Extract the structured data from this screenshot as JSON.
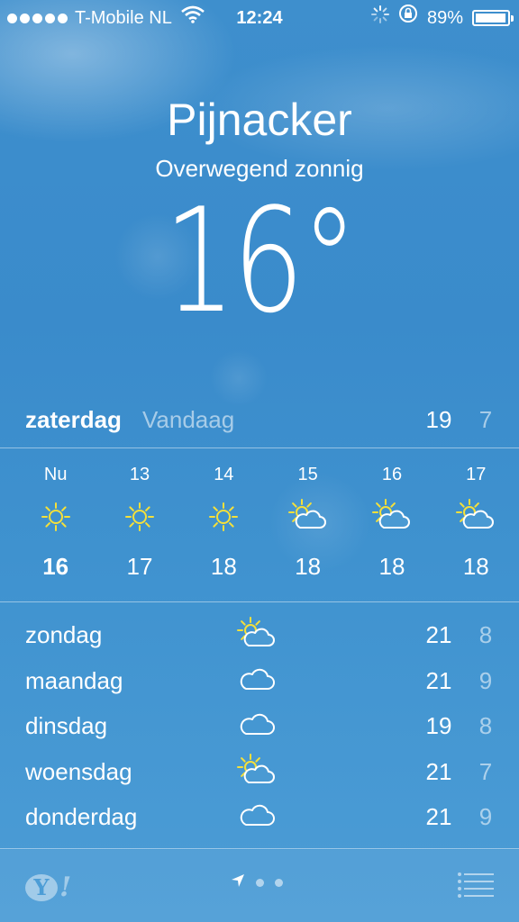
{
  "status_bar": {
    "carrier": "T-Mobile NL",
    "time": "12:24",
    "battery": "89%",
    "battery_level": 0.89,
    "icons": [
      "signal-dots-icon",
      "wifi-icon",
      "activity-spinner-icon",
      "orientation-lock-icon",
      "battery-icon"
    ]
  },
  "location": {
    "city": "Pijnacker",
    "condition": "Overwegend zonnig",
    "temperature": "16°"
  },
  "today": {
    "day": "zaterdag",
    "label": "Vandaag",
    "high": "19",
    "low": "7"
  },
  "hourly": [
    {
      "time": "Nu",
      "icon": "sun-icon",
      "temp": "16"
    },
    {
      "time": "13",
      "icon": "sun-icon",
      "temp": "17"
    },
    {
      "time": "14",
      "icon": "sun-icon",
      "temp": "18"
    },
    {
      "time": "15",
      "icon": "partly-cloudy-icon",
      "temp": "18"
    },
    {
      "time": "16",
      "icon": "partly-cloudy-icon",
      "temp": "18"
    },
    {
      "time": "17",
      "icon": "partly-cloudy-icon",
      "temp": "18"
    }
  ],
  "daily": [
    {
      "day": "zondag",
      "icon": "partly-cloudy-icon",
      "high": "21",
      "low": "8"
    },
    {
      "day": "maandag",
      "icon": "cloud-icon",
      "high": "21",
      "low": "9"
    },
    {
      "day": "dinsdag",
      "icon": "cloud-icon",
      "high": "19",
      "low": "8"
    },
    {
      "day": "woensdag",
      "icon": "partly-cloudy-icon",
      "high": "21",
      "low": "7"
    },
    {
      "day": "donderdag",
      "icon": "cloud-icon",
      "high": "21",
      "low": "9"
    }
  ],
  "footer": {
    "yahoo_logo": "Y!",
    "pages": 3,
    "current_page": 1,
    "icons": [
      "yahoo-logo-icon",
      "location-arrow-icon",
      "list-icon"
    ]
  },
  "colors": {
    "background": "#3e8fcd",
    "sun": "#f5e03a",
    "text": "#ffffff"
  }
}
